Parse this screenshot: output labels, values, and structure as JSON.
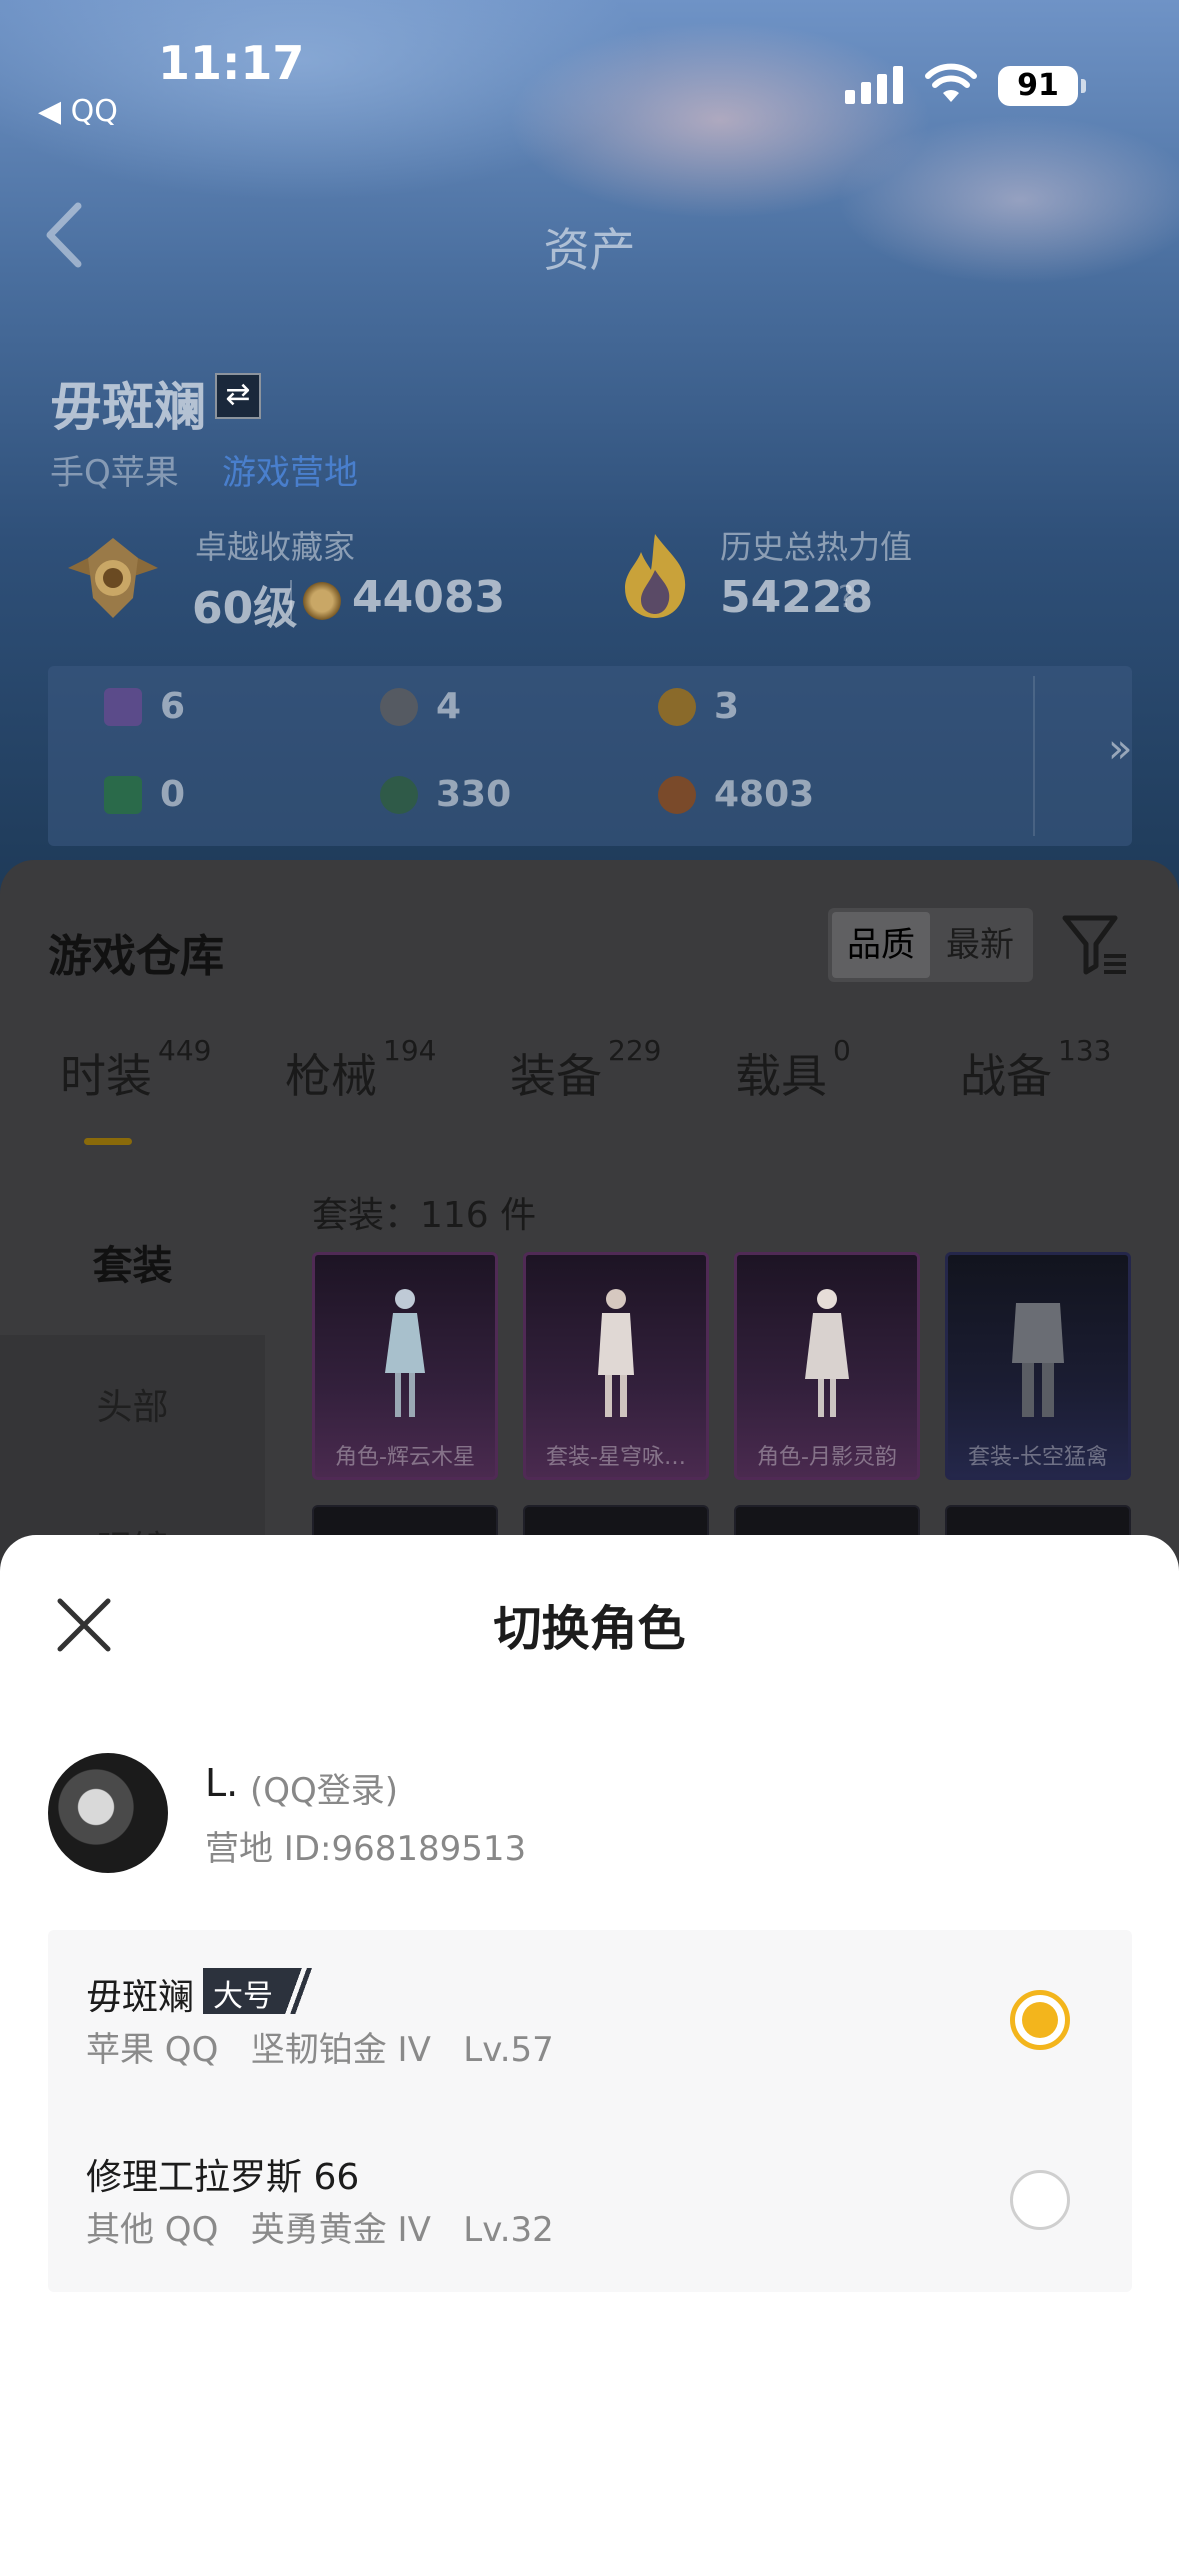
{
  "status_bar": {
    "time": "11:17",
    "back_app": "◀ QQ",
    "battery": "91"
  },
  "nav": {
    "title": "资产"
  },
  "profile": {
    "name": "毋斑斓",
    "platform": "手Q苹果",
    "link_text": "游戏营地",
    "rank_title": "卓越收藏家",
    "rank_level": "60级",
    "rank_coins": "44083",
    "heat_title": "历史总热力值",
    "heat_value": "54228",
    "heat_help": "?"
  },
  "resources": {
    "items": [
      {
        "value": "6",
        "color": "#5b4b8a"
      },
      {
        "value": "4",
        "color": "#555a62"
      },
      {
        "value": "3",
        "color": "#8a6a2a"
      },
      {
        "value": "0",
        "color": "#2a6a4a"
      },
      {
        "value": "330",
        "color": "#2f5a48"
      },
      {
        "value": "4803",
        "color": "#7a4a2a"
      }
    ],
    "more": "»"
  },
  "warehouse": {
    "title": "游戏仓库",
    "sort_quality": "品质",
    "sort_latest": "最新",
    "tabs": [
      {
        "label": "时装",
        "count": "449"
      },
      {
        "label": "枪械",
        "count": "194"
      },
      {
        "label": "装备",
        "count": "229"
      },
      {
        "label": "载具",
        "count": "0"
      },
      {
        "label": "战备",
        "count": "133"
      }
    ],
    "subcategories": [
      "套装",
      "头部",
      "眼镜"
    ],
    "suit_count": "套装：116 件",
    "cards": [
      {
        "label": "角色-辉云木星"
      },
      {
        "label": "套装-星穹咏…"
      },
      {
        "label": "角色-月影灵韵"
      },
      {
        "label": "套装-长空猛禽"
      }
    ]
  },
  "sheet": {
    "title": "切换角色",
    "account_name": "L.",
    "account_login": "(QQ登录)",
    "account_id": "营地 ID:968189513",
    "roles": [
      {
        "name": "毋斑斓",
        "badge": "大号",
        "info": "苹果 QQ   坚韧铂金 IV   Lv.57",
        "selected": true
      },
      {
        "name": "修理工拉罗斯 66",
        "badge": "",
        "info": "其他 QQ   英勇黄金 IV   Lv.32",
        "selected": false
      }
    ]
  },
  "colors": {
    "accent": "#f3b51c",
    "tab_underline": "#8a6a0a"
  }
}
